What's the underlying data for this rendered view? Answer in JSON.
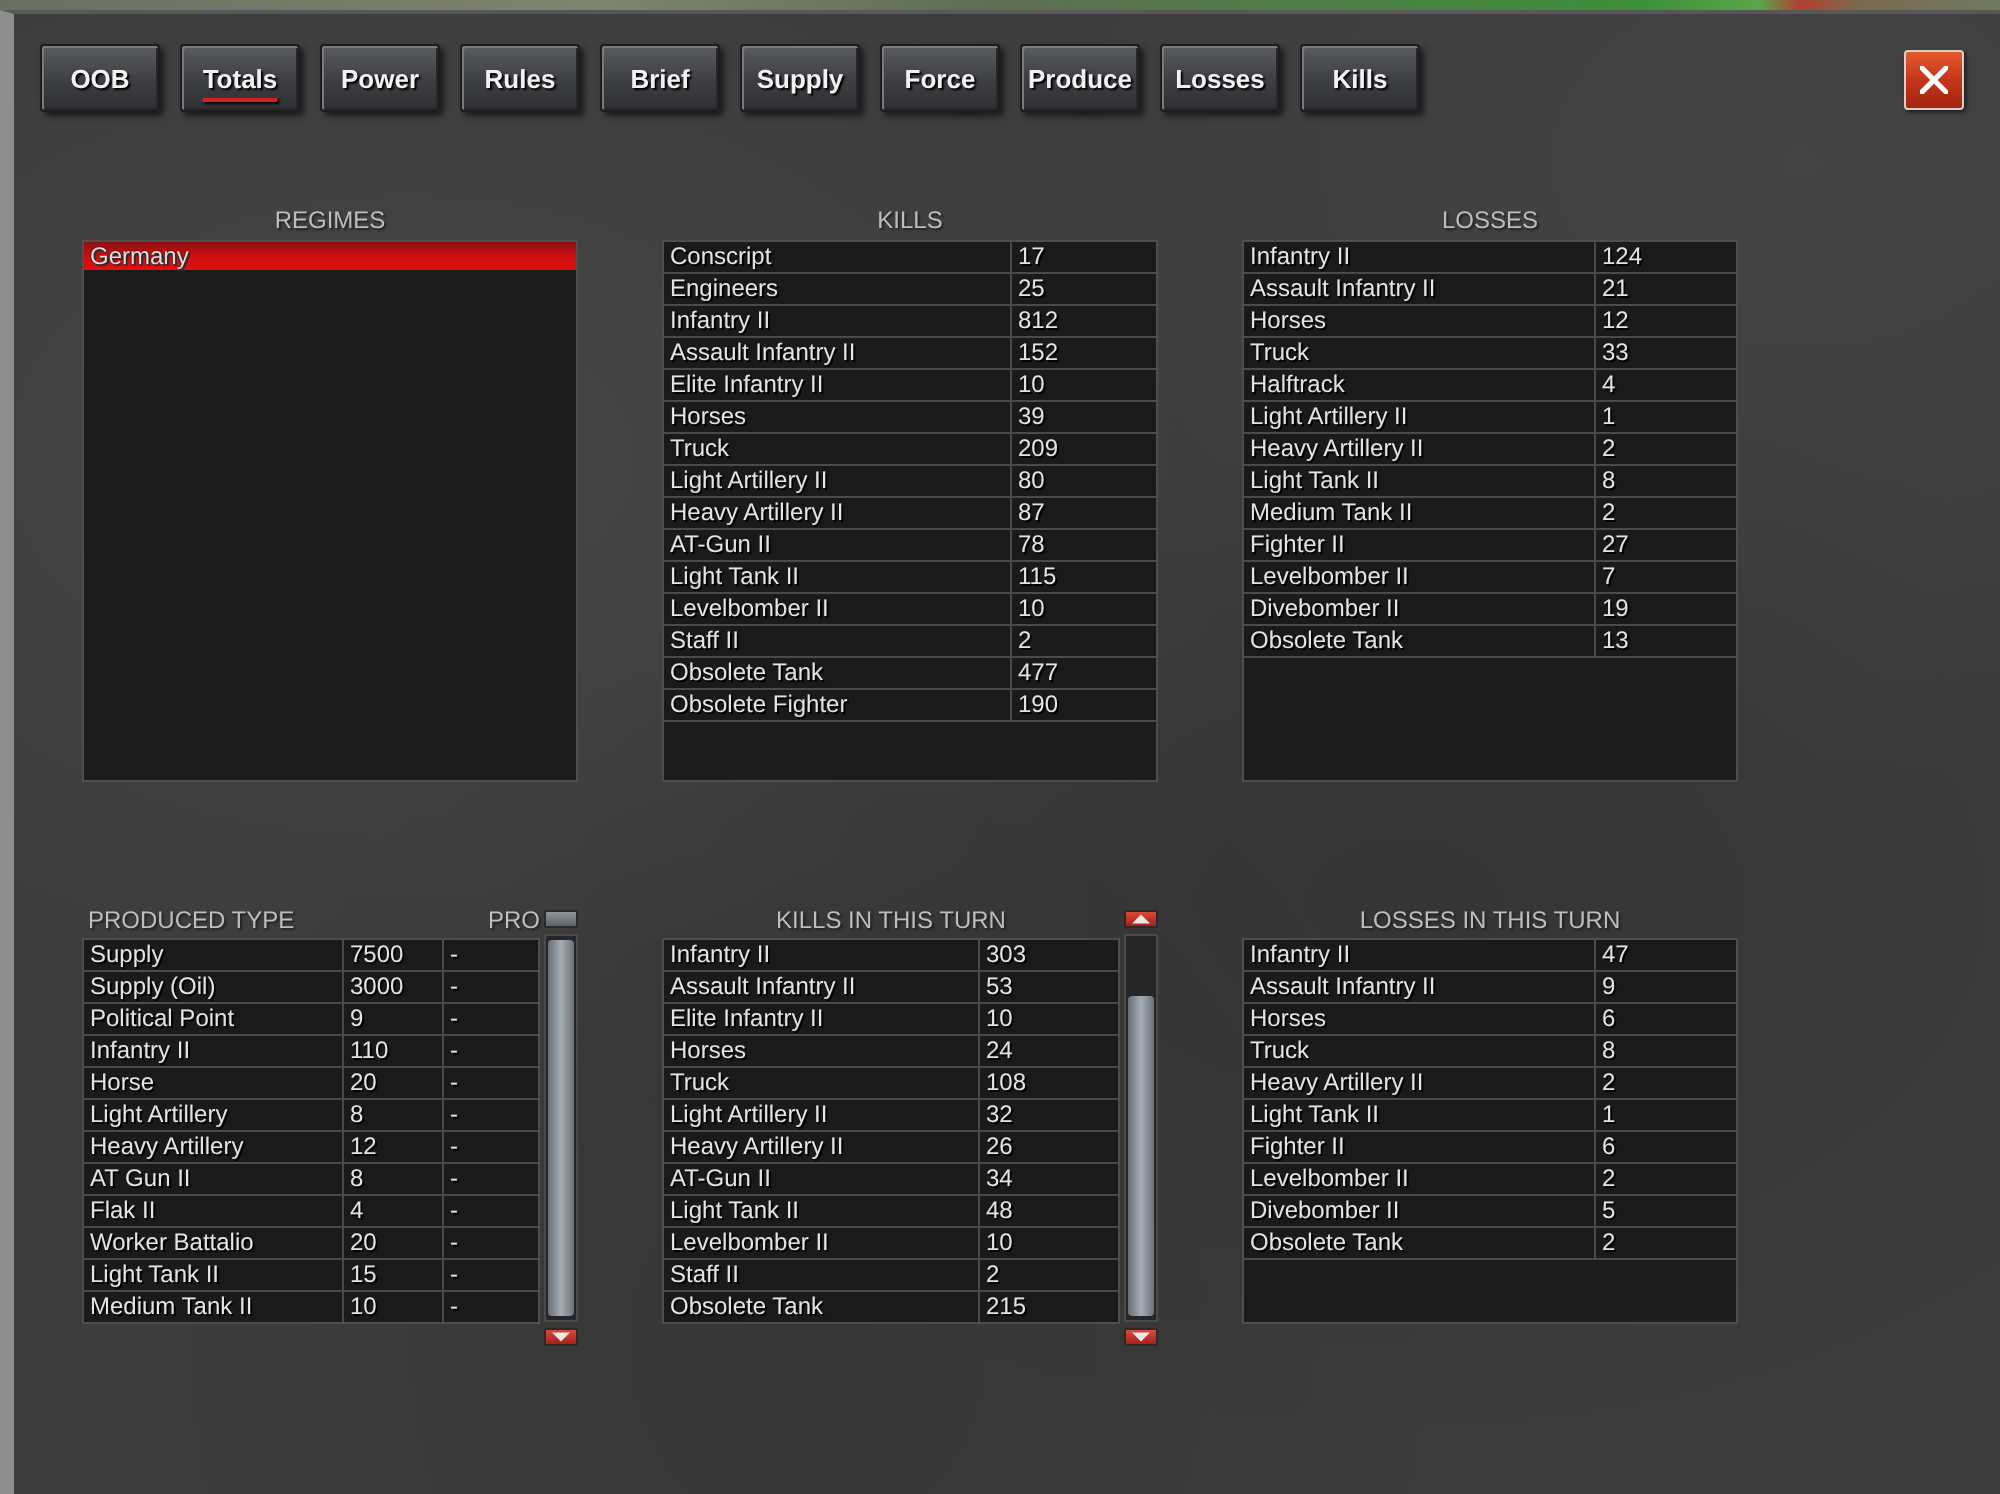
{
  "tabs": [
    {
      "label": "OOB",
      "selected": false
    },
    {
      "label": "Totals",
      "selected": true
    },
    {
      "label": "Power",
      "selected": false
    },
    {
      "label": "Rules",
      "selected": false
    },
    {
      "label": "Brief",
      "selected": false
    },
    {
      "label": "Supply",
      "selected": false
    },
    {
      "label": "Force",
      "selected": false
    },
    {
      "label": "Produce",
      "selected": false
    },
    {
      "label": "Losses",
      "selected": false
    },
    {
      "label": "Kills",
      "selected": false
    }
  ],
  "regimes": {
    "title": "REGIMES",
    "items": [
      {
        "label": "Germany",
        "selected": true
      }
    ]
  },
  "kills": {
    "title": "KILLS",
    "rows": [
      [
        "Conscript",
        "17"
      ],
      [
        "Engineers",
        "25"
      ],
      [
        "Infantry II",
        "812"
      ],
      [
        "Assault Infantry II",
        "152"
      ],
      [
        "Elite Infantry II",
        "10"
      ],
      [
        "Horses",
        "39"
      ],
      [
        "Truck",
        "209"
      ],
      [
        "Light Artillery II",
        "80"
      ],
      [
        "Heavy Artillery II",
        "87"
      ],
      [
        "AT-Gun II",
        "78"
      ],
      [
        "Light Tank II",
        "115"
      ],
      [
        "Levelbomber II",
        "10"
      ],
      [
        "Staff II",
        "2"
      ],
      [
        "Obsolete Tank",
        "477"
      ],
      [
        "Obsolete Fighter",
        "190"
      ]
    ]
  },
  "losses": {
    "title": "LOSSES",
    "rows": [
      [
        "Infantry II",
        "124"
      ],
      [
        "Assault Infantry II",
        "21"
      ],
      [
        "Horses",
        "12"
      ],
      [
        "Truck",
        "33"
      ],
      [
        "Halftrack",
        "4"
      ],
      [
        "Light Artillery II",
        "1"
      ],
      [
        "Heavy Artillery II",
        "2"
      ],
      [
        "Light Tank II",
        "8"
      ],
      [
        "Medium Tank II",
        "2"
      ],
      [
        "Fighter II",
        "27"
      ],
      [
        "Levelbomber II",
        "7"
      ],
      [
        "Divebomber II",
        "19"
      ],
      [
        "Obsolete Tank",
        "13"
      ]
    ]
  },
  "produced": {
    "headings": [
      "PRODUCED TYPE",
      "PRO"
    ],
    "rows": [
      [
        "Supply",
        "7500",
        "-"
      ],
      [
        "Supply (Oil)",
        "3000",
        "-"
      ],
      [
        "Political Point",
        "9",
        "-"
      ],
      [
        "Infantry II",
        "110",
        "-"
      ],
      [
        "Horse",
        "20",
        "-"
      ],
      [
        "Light Artillery",
        "8",
        "-"
      ],
      [
        "Heavy Artillery",
        "12",
        "-"
      ],
      [
        "AT Gun II",
        "8",
        "-"
      ],
      [
        "Flak II",
        "4",
        "-"
      ],
      [
        "Worker Battalio",
        "20",
        "-"
      ],
      [
        "Light Tank II",
        "15",
        "-"
      ],
      [
        "Medium Tank II",
        "10",
        "-"
      ]
    ]
  },
  "kills_this_turn": {
    "title": "KILLS IN THIS TURN",
    "rows": [
      [
        "Infantry II",
        "303"
      ],
      [
        "Assault Infantry II",
        "53"
      ],
      [
        "Elite Infantry II",
        "10"
      ],
      [
        "Horses",
        "24"
      ],
      [
        "Truck",
        "108"
      ],
      [
        "Light Artillery II",
        "32"
      ],
      [
        "Heavy Artillery II",
        "26"
      ],
      [
        "AT-Gun II",
        "34"
      ],
      [
        "Light Tank II",
        "48"
      ],
      [
        "Levelbomber II",
        "10"
      ],
      [
        "Staff II",
        "2"
      ],
      [
        "Obsolete Tank",
        "215"
      ]
    ]
  },
  "losses_this_turn": {
    "title": "LOSSES IN THIS TURN",
    "rows": [
      [
        "Infantry II",
        "47"
      ],
      [
        "Assault Infantry II",
        "9"
      ],
      [
        "Horses",
        "6"
      ],
      [
        "Truck",
        "8"
      ],
      [
        "Heavy Artillery II",
        "2"
      ],
      [
        "Light Tank II",
        "1"
      ],
      [
        "Fighter II",
        "6"
      ],
      [
        "Levelbomber II",
        "2"
      ],
      [
        "Divebomber II",
        "5"
      ],
      [
        "Obsolete Tank",
        "2"
      ]
    ]
  }
}
